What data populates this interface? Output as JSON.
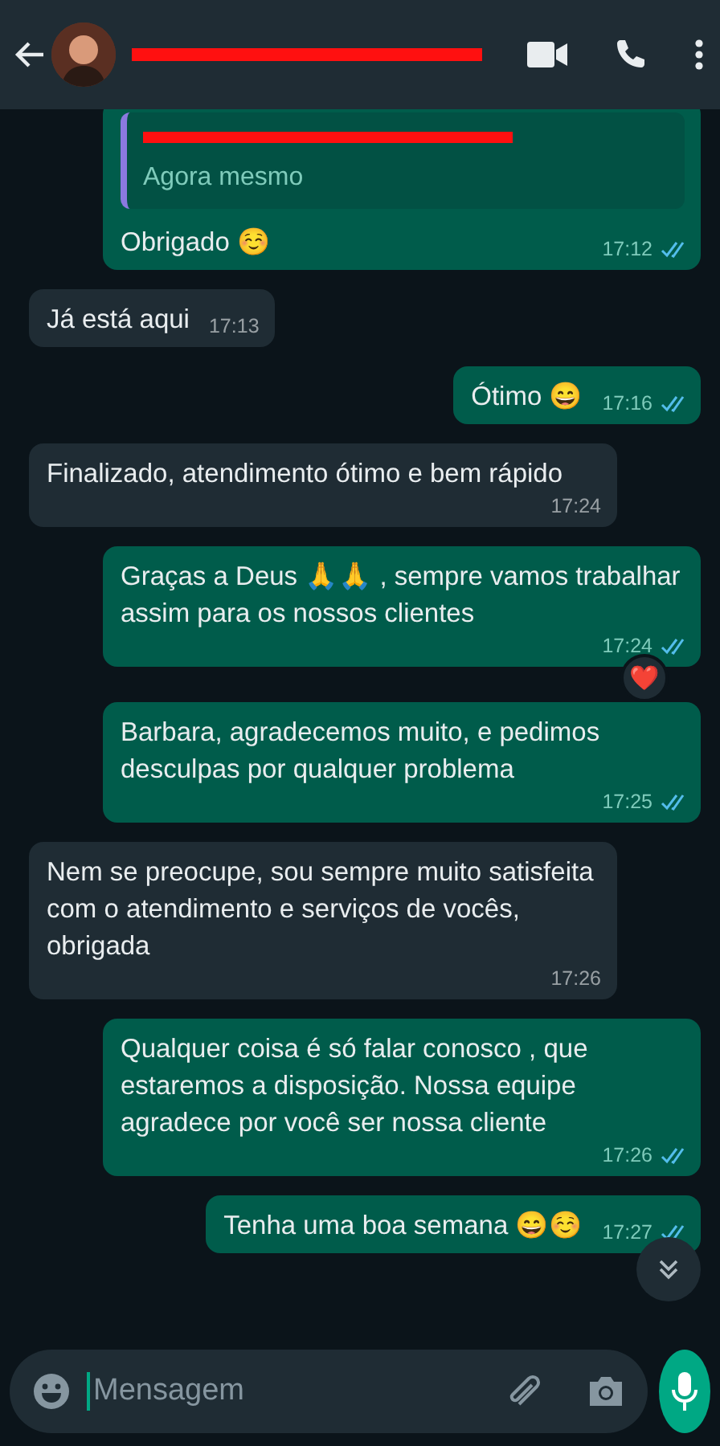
{
  "header": {
    "redacted_name": true
  },
  "messages": [
    {
      "kind": "out",
      "quote": {
        "redacted_author": true,
        "text": "Agora mesmo"
      },
      "text": "Obrigado ☺️",
      "time": "17:12",
      "read": true
    },
    {
      "kind": "in",
      "text": "Já está aqui",
      "time": "17:13"
    },
    {
      "kind": "out",
      "text": "Ótimo 😄",
      "time": "17:16",
      "read": true
    },
    {
      "kind": "in",
      "text": "Finalizado, atendimento ótimo e bem rápido",
      "time": "17:24"
    },
    {
      "kind": "out",
      "text": "Graças a Deus 🙏🙏 , sempre vamos trabalhar assim para os nossos clientes",
      "time": "17:24",
      "read": true,
      "reaction": "❤️"
    },
    {
      "kind": "out",
      "text": "Barbara, agradecemos muito, e pedimos desculpas por qualquer problema",
      "time": "17:25",
      "read": true
    },
    {
      "kind": "in",
      "text": "Nem se preocupe, sou sempre muito satisfeita com o atendimento e serviços de vocês, obrigada",
      "time": "17:26"
    },
    {
      "kind": "out",
      "text": "Qualquer coisa é só falar conosco , que estaremos a disposição. Nossa equipe agradece por você ser nossa cliente",
      "time": "17:26",
      "read": true
    },
    {
      "kind": "out",
      "text": "Tenha uma boa semana 😄☺️",
      "time": "17:27",
      "read": true
    }
  ],
  "composer": {
    "placeholder": "Mensagem"
  }
}
